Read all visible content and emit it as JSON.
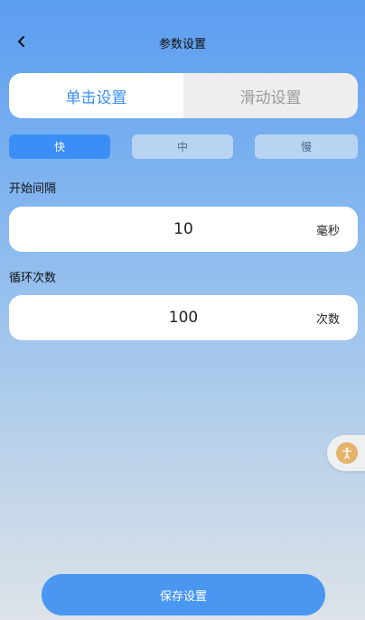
{
  "header": {
    "title": "参数设置",
    "back_icon": "chevron-left-icon"
  },
  "mode_tabs": [
    {
      "label": "单击设置",
      "active": true
    },
    {
      "label": "滑动设置",
      "active": false
    }
  ],
  "speed_options": [
    {
      "label": "快",
      "active": true
    },
    {
      "label": "中",
      "active": false
    },
    {
      "label": "慢",
      "active": false
    }
  ],
  "start_interval": {
    "label": "开始间隔",
    "value": "10",
    "unit": "毫秒"
  },
  "loop_count": {
    "label": "循环次数",
    "value": "100",
    "unit": "次数"
  },
  "save_button": {
    "label": "保存设置"
  },
  "floating_button": {
    "icon": "accessibility-icon"
  },
  "colors": {
    "accent": "#3a8ef6",
    "save_button": "#4a97f2",
    "inactive_speed": "#b9d3f3",
    "float_icon": "#e4b46d"
  }
}
